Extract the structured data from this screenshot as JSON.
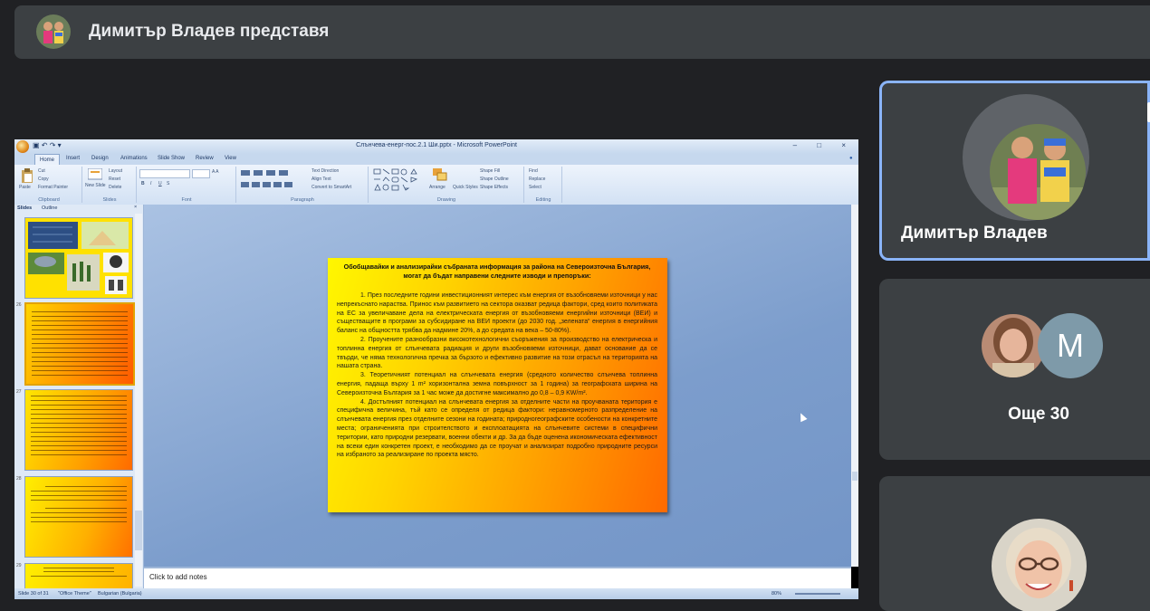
{
  "banner": {
    "title": "Димитър Владев представя",
    "avatar_icon": "presenter-avatar-photo"
  },
  "powerpoint": {
    "window_title": "Слънчева-енерг-пос.2.1 Ши.pptx - Microsoft PowerPoint",
    "quick_access": "▣ ↶ ↷ ▾",
    "window_controls": "– □ ×",
    "tabs": [
      "Home",
      "Insert",
      "Design",
      "Animations",
      "Slide Show",
      "Review",
      "View"
    ],
    "ribbon": {
      "clipboard": {
        "label": "Clipboard",
        "paste": "Paste",
        "cut": "Cut",
        "copy": "Copy",
        "format_painter": "Format Painter"
      },
      "slides": {
        "label": "Slides",
        "new_slide": "New Slide",
        "layout": "Layout",
        "reset": "Reset",
        "delete": "Delete"
      },
      "font": {
        "label": "Font"
      },
      "paragraph": {
        "label": "Paragraph",
        "text_direction": "Text Direction",
        "align_text": "Align Text",
        "convert_smartart": "Convert to SmartArt"
      },
      "drawing": {
        "label": "Drawing",
        "arrange": "Arrange",
        "quick_styles": "Quick Styles",
        "shape_fill": "Shape Fill",
        "shape_outline": "Shape Outline",
        "shape_effects": "Shape Effects"
      },
      "editing": {
        "label": "Editing",
        "find": "Find",
        "replace": "Replace",
        "select": "Select"
      }
    },
    "panel_tabs": {
      "slides": "Slides",
      "outline": "Outline"
    },
    "thumbnail_numbers": [
      "26",
      "27",
      "28",
      "29"
    ],
    "notes_placeholder": "Click to add notes",
    "status": {
      "slide_counter": "Slide 30 of 31",
      "theme": "\"Office Theme\"",
      "language": "Bulgarian (Bulgaria)",
      "zoom": "80%"
    },
    "slide": {
      "heading": "Обобщавайки и анализирайки събраната информация за района на Североизточна България, могат да бъдат направени следните изводи и препоръки:",
      "paragraphs": [
        "1. През последните години инвестиционният интерес към енергия от възобновяеми източници у нас непрекъснато нараства. Принос към развитието на сектора оказват редица фактори, сред които политиката на ЕС за увеличаване дела на електрическата енергия от възобновяеми енергийни източници (ВЕИ) и съществащите в програми за субсидиране на ВЕИ проекти (до 2030 год. „зелената“ енергия в енергийния баланс на общността трябва да надмине 20%, а до средата на века – 50-80%).",
        "2. Проучените разнообразни високотехнологични съоръжения за производство на електрическа и топлинна енергия от слънчевата радиация и други възобновяеми източници, дават основание да се твърди, че няма технологична пречка за бързото и ефективно развитие на този отрасъл на територията на нашата страна.",
        "3. Теоретичният потенциал на слънчевата енергия (средното количество слънчева топлинна енергия, падаща върху 1 m² хоризонтална земна повърхност за 1 година) за географската ширина на Североизточна България за 1 час може да достигне максимално до 0,8 – 0,9 KW/m².",
        "4. Достъпният потенциал на слънчевата енергия за отделните части на проучваната територия е специфична величина, тъй като се определя от редица фактори: неравномерното разпределение на слънчевата енергия през отделните сезони на годината; природногеографските особености на конкретните места; ограниченията при строителството и експлоатацията на слънчевите системи в специфични територии, като природни резервати, военни обекти и др. За да бъде оценена икономическата ефективност на всеки един конкретен проект, е необходимо да се проучат и анализират подробно природните ресурси на избраното за реализиране по проекта място."
      ]
    }
  },
  "participants": [
    {
      "name": "Димитър Владев",
      "avatar_icon": "children-photo-avatar"
    },
    {
      "name": "Още 30",
      "initial": "M",
      "avatar_icon": "woman-photo-avatar"
    },
    {
      "avatar_icon": "smiling-woman-photo-avatar"
    }
  ],
  "colors": {
    "active_speaker": "#8ab4f8",
    "tile_bg": "#3c4043",
    "page_bg": "#202124",
    "avatar_m": "#7e9aa9"
  }
}
